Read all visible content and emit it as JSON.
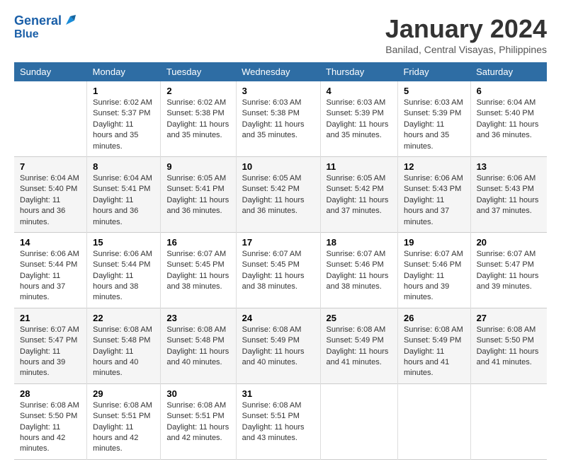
{
  "app": {
    "name_line1": "General",
    "name_line2": "Blue"
  },
  "header": {
    "month": "January 2024",
    "location": "Banilad, Central Visayas, Philippines"
  },
  "days_of_week": [
    "Sunday",
    "Monday",
    "Tuesday",
    "Wednesday",
    "Thursday",
    "Friday",
    "Saturday"
  ],
  "weeks": [
    [
      {
        "day": "",
        "sunrise": "",
        "sunset": "",
        "daylight": ""
      },
      {
        "day": "1",
        "sunrise": "Sunrise: 6:02 AM",
        "sunset": "Sunset: 5:37 PM",
        "daylight": "Daylight: 11 hours and 35 minutes."
      },
      {
        "day": "2",
        "sunrise": "Sunrise: 6:02 AM",
        "sunset": "Sunset: 5:38 PM",
        "daylight": "Daylight: 11 hours and 35 minutes."
      },
      {
        "day": "3",
        "sunrise": "Sunrise: 6:03 AM",
        "sunset": "Sunset: 5:38 PM",
        "daylight": "Daylight: 11 hours and 35 minutes."
      },
      {
        "day": "4",
        "sunrise": "Sunrise: 6:03 AM",
        "sunset": "Sunset: 5:39 PM",
        "daylight": "Daylight: 11 hours and 35 minutes."
      },
      {
        "day": "5",
        "sunrise": "Sunrise: 6:03 AM",
        "sunset": "Sunset: 5:39 PM",
        "daylight": "Daylight: 11 hours and 35 minutes."
      },
      {
        "day": "6",
        "sunrise": "Sunrise: 6:04 AM",
        "sunset": "Sunset: 5:40 PM",
        "daylight": "Daylight: 11 hours and 36 minutes."
      }
    ],
    [
      {
        "day": "7",
        "sunrise": "Sunrise: 6:04 AM",
        "sunset": "Sunset: 5:40 PM",
        "daylight": "Daylight: 11 hours and 36 minutes."
      },
      {
        "day": "8",
        "sunrise": "Sunrise: 6:04 AM",
        "sunset": "Sunset: 5:41 PM",
        "daylight": "Daylight: 11 hours and 36 minutes."
      },
      {
        "day": "9",
        "sunrise": "Sunrise: 6:05 AM",
        "sunset": "Sunset: 5:41 PM",
        "daylight": "Daylight: 11 hours and 36 minutes."
      },
      {
        "day": "10",
        "sunrise": "Sunrise: 6:05 AM",
        "sunset": "Sunset: 5:42 PM",
        "daylight": "Daylight: 11 hours and 36 minutes."
      },
      {
        "day": "11",
        "sunrise": "Sunrise: 6:05 AM",
        "sunset": "Sunset: 5:42 PM",
        "daylight": "Daylight: 11 hours and 37 minutes."
      },
      {
        "day": "12",
        "sunrise": "Sunrise: 6:06 AM",
        "sunset": "Sunset: 5:43 PM",
        "daylight": "Daylight: 11 hours and 37 minutes."
      },
      {
        "day": "13",
        "sunrise": "Sunrise: 6:06 AM",
        "sunset": "Sunset: 5:43 PM",
        "daylight": "Daylight: 11 hours and 37 minutes."
      }
    ],
    [
      {
        "day": "14",
        "sunrise": "Sunrise: 6:06 AM",
        "sunset": "Sunset: 5:44 PM",
        "daylight": "Daylight: 11 hours and 37 minutes."
      },
      {
        "day": "15",
        "sunrise": "Sunrise: 6:06 AM",
        "sunset": "Sunset: 5:44 PM",
        "daylight": "Daylight: 11 hours and 38 minutes."
      },
      {
        "day": "16",
        "sunrise": "Sunrise: 6:07 AM",
        "sunset": "Sunset: 5:45 PM",
        "daylight": "Daylight: 11 hours and 38 minutes."
      },
      {
        "day": "17",
        "sunrise": "Sunrise: 6:07 AM",
        "sunset": "Sunset: 5:45 PM",
        "daylight": "Daylight: 11 hours and 38 minutes."
      },
      {
        "day": "18",
        "sunrise": "Sunrise: 6:07 AM",
        "sunset": "Sunset: 5:46 PM",
        "daylight": "Daylight: 11 hours and 38 minutes."
      },
      {
        "day": "19",
        "sunrise": "Sunrise: 6:07 AM",
        "sunset": "Sunset: 5:46 PM",
        "daylight": "Daylight: 11 hours and 39 minutes."
      },
      {
        "day": "20",
        "sunrise": "Sunrise: 6:07 AM",
        "sunset": "Sunset: 5:47 PM",
        "daylight": "Daylight: 11 hours and 39 minutes."
      }
    ],
    [
      {
        "day": "21",
        "sunrise": "Sunrise: 6:07 AM",
        "sunset": "Sunset: 5:47 PM",
        "daylight": "Daylight: 11 hours and 39 minutes."
      },
      {
        "day": "22",
        "sunrise": "Sunrise: 6:08 AM",
        "sunset": "Sunset: 5:48 PM",
        "daylight": "Daylight: 11 hours and 40 minutes."
      },
      {
        "day": "23",
        "sunrise": "Sunrise: 6:08 AM",
        "sunset": "Sunset: 5:48 PM",
        "daylight": "Daylight: 11 hours and 40 minutes."
      },
      {
        "day": "24",
        "sunrise": "Sunrise: 6:08 AM",
        "sunset": "Sunset: 5:49 PM",
        "daylight": "Daylight: 11 hours and 40 minutes."
      },
      {
        "day": "25",
        "sunrise": "Sunrise: 6:08 AM",
        "sunset": "Sunset: 5:49 PM",
        "daylight": "Daylight: 11 hours and 41 minutes."
      },
      {
        "day": "26",
        "sunrise": "Sunrise: 6:08 AM",
        "sunset": "Sunset: 5:49 PM",
        "daylight": "Daylight: 11 hours and 41 minutes."
      },
      {
        "day": "27",
        "sunrise": "Sunrise: 6:08 AM",
        "sunset": "Sunset: 5:50 PM",
        "daylight": "Daylight: 11 hours and 41 minutes."
      }
    ],
    [
      {
        "day": "28",
        "sunrise": "Sunrise: 6:08 AM",
        "sunset": "Sunset: 5:50 PM",
        "daylight": "Daylight: 11 hours and 42 minutes."
      },
      {
        "day": "29",
        "sunrise": "Sunrise: 6:08 AM",
        "sunset": "Sunset: 5:51 PM",
        "daylight": "Daylight: 11 hours and 42 minutes."
      },
      {
        "day": "30",
        "sunrise": "Sunrise: 6:08 AM",
        "sunset": "Sunset: 5:51 PM",
        "daylight": "Daylight: 11 hours and 42 minutes."
      },
      {
        "day": "31",
        "sunrise": "Sunrise: 6:08 AM",
        "sunset": "Sunset: 5:51 PM",
        "daylight": "Daylight: 11 hours and 43 minutes."
      },
      {
        "day": "",
        "sunrise": "",
        "sunset": "",
        "daylight": ""
      },
      {
        "day": "",
        "sunrise": "",
        "sunset": "",
        "daylight": ""
      },
      {
        "day": "",
        "sunrise": "",
        "sunset": "",
        "daylight": ""
      }
    ]
  ]
}
